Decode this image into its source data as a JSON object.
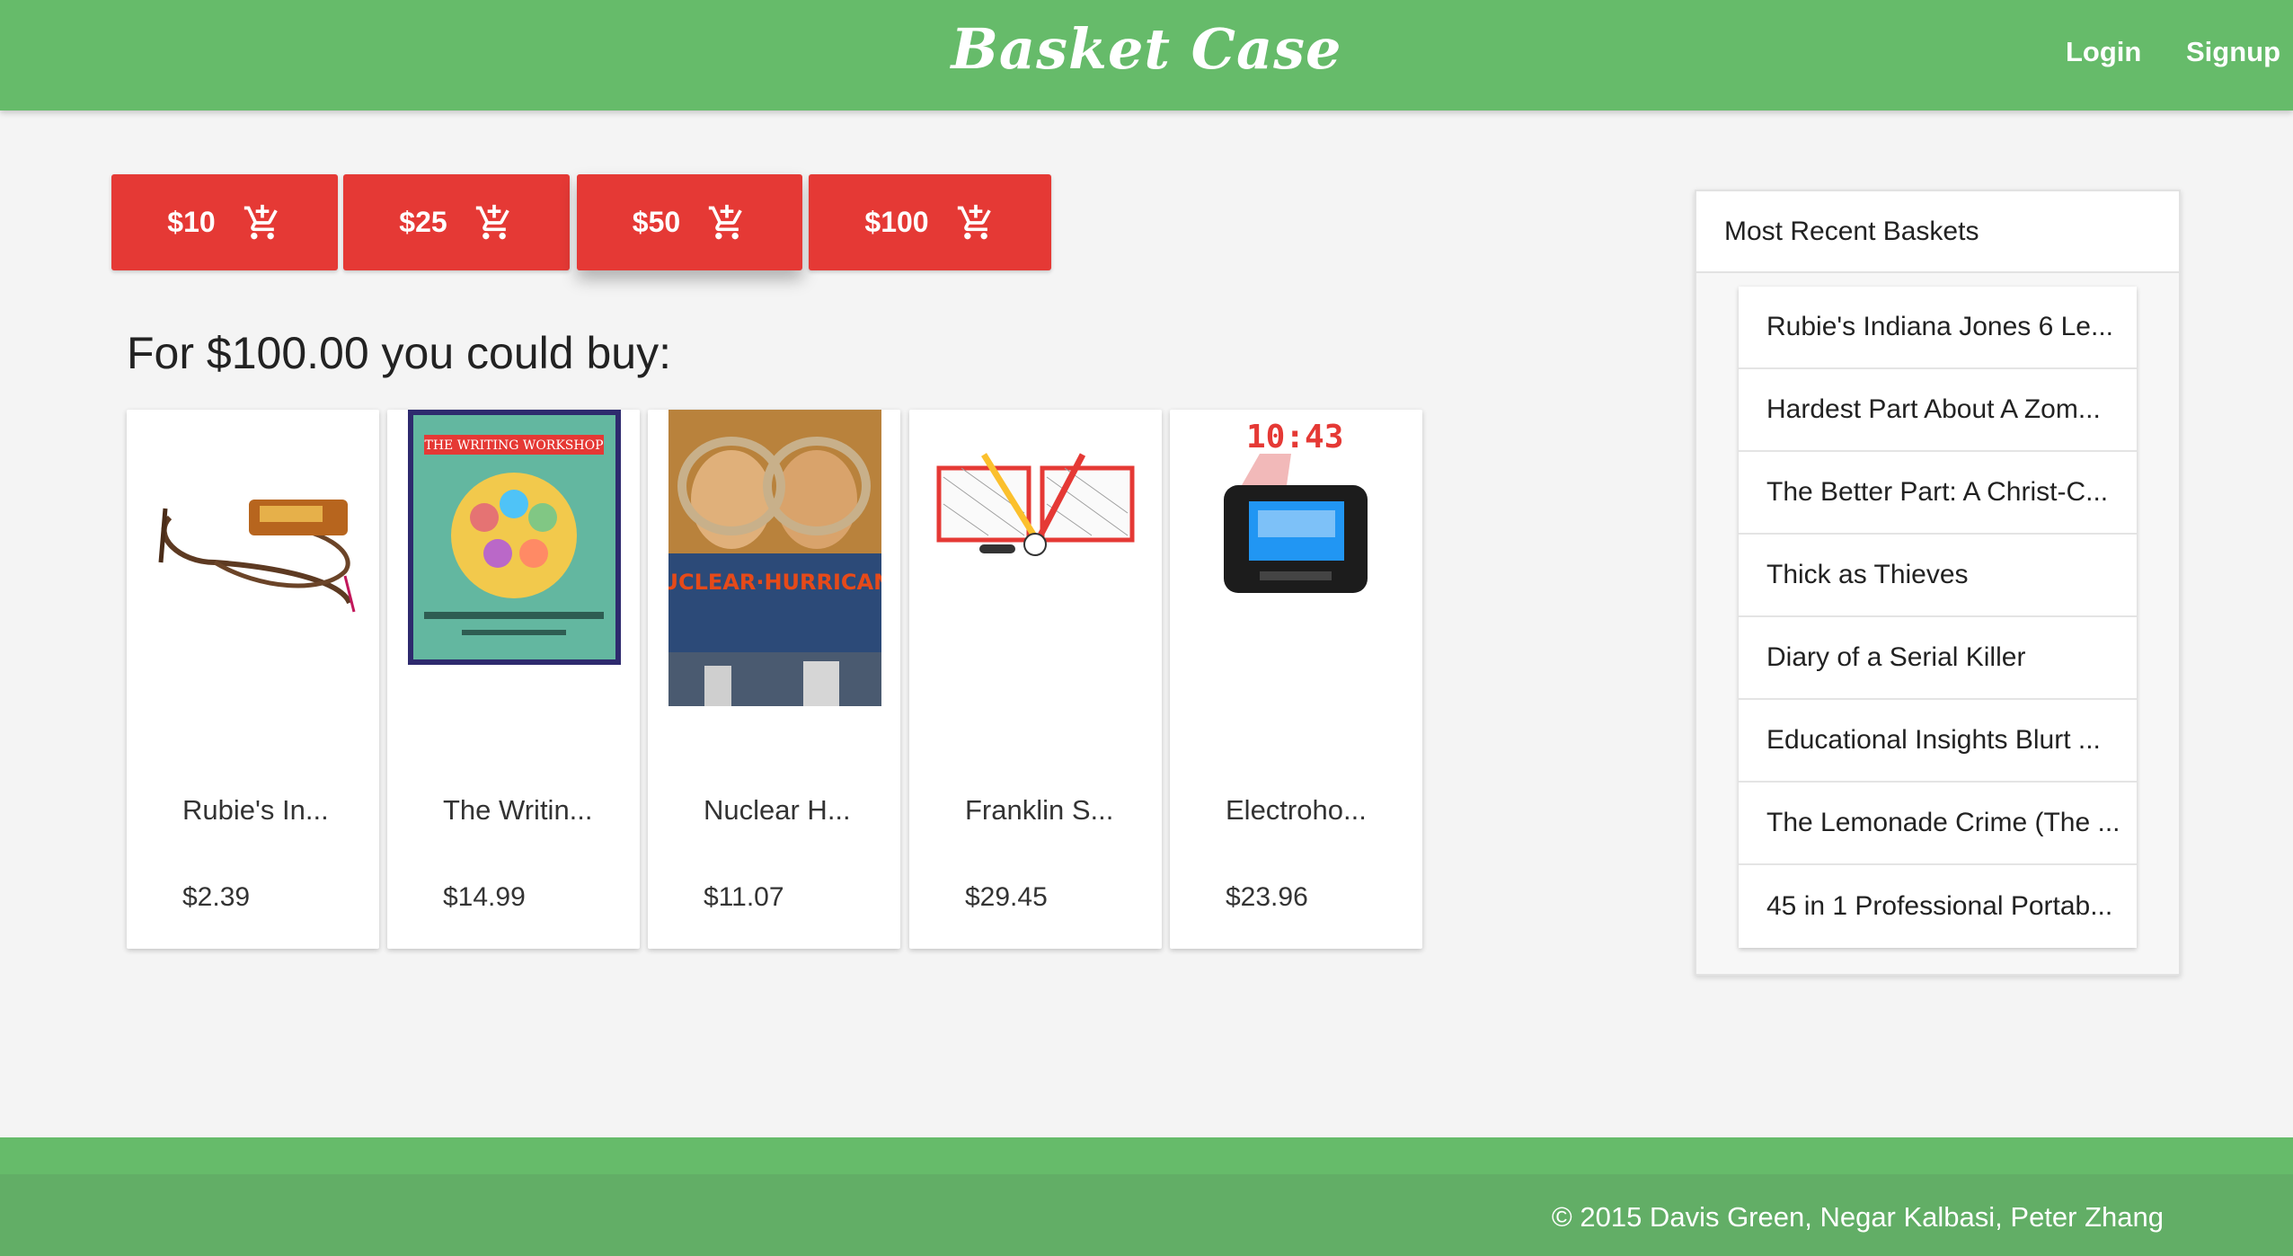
{
  "header": {
    "brand": "Basket Case",
    "login_label": "Login",
    "signup_label": "Signup"
  },
  "amounts": [
    {
      "label": "$10"
    },
    {
      "label": "$25"
    },
    {
      "label": "$50"
    },
    {
      "label": "$100"
    }
  ],
  "headline": "For $100.00 you could buy:",
  "products": [
    {
      "title": "Rubie's In...",
      "price": "$2.39"
    },
    {
      "title": "The Writin...",
      "price": "$14.99"
    },
    {
      "title": "Nuclear H...",
      "price": "$11.07"
    },
    {
      "title": "Franklin S...",
      "price": "$29.45"
    },
    {
      "title": "Electroho...",
      "price": "$23.96"
    }
  ],
  "product_images": {
    "book_banner": "THE WRITING WORKSHOP",
    "dvd_title": "NUCLEAR·HURRICANE",
    "clock_time": "10:43"
  },
  "recent": {
    "title": "Most Recent Baskets",
    "items": [
      "Rubie's Indiana Jones 6 Le...",
      "Hardest Part About A Zom...",
      "The Better Part: A Christ-C...",
      "Thick as Thieves",
      "Diary of a Serial Killer",
      "Educational Insights Blurt ...",
      "The Lemonade Crime (The ...",
      "45 in 1 Professional Portab..."
    ]
  },
  "footer": {
    "copyright": "© 2015 Davis Green, Negar Kalbasi, Peter Zhang"
  },
  "colors": {
    "header_green": "#66bb6a",
    "button_red": "#e53935",
    "footer_green": "#62ae66"
  },
  "icons": {
    "cart": "add-shopping-cart-icon"
  }
}
